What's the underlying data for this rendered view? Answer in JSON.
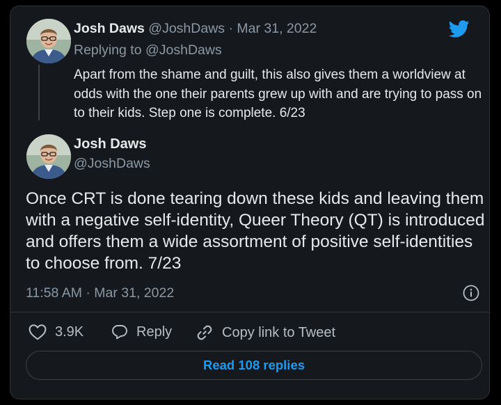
{
  "tweet1": {
    "name": "Josh Daws",
    "handle": "@JoshDaws",
    "separator": " · ",
    "date": "Mar 31, 2022",
    "replying_to_label": "Replying to ",
    "replying_to_handle": "@JoshDaws",
    "text": "Apart from the shame and guilt, this also gives them a worldview at odds with the one their parents grew up with and are trying to pass on to their kids. Step one is complete. 6/23"
  },
  "tweet2": {
    "name": "Josh Daws",
    "handle": "@JoshDaws",
    "text": "Once CRT is done tearing down these kids and leaving them with a negative self-identity, Queer Theory (QT) is introduced and offers them a wide assortment of positive self-identities to choose from. 7/23",
    "timestamp": "11:58 AM · Mar 31, 2022"
  },
  "actions": {
    "likes": "3.9K",
    "reply_label": "Reply",
    "copy_link_label": "Copy link to Tweet"
  },
  "read_replies_label": "Read 108 replies",
  "colors": {
    "background": "#15181c",
    "accent": "#1d9bf0",
    "muted": "#8b98a5",
    "text": "#e7e9ea"
  },
  "icons": [
    "twitter-bird-icon",
    "info-icon",
    "heart-icon",
    "reply-bubble-icon",
    "link-icon"
  ]
}
